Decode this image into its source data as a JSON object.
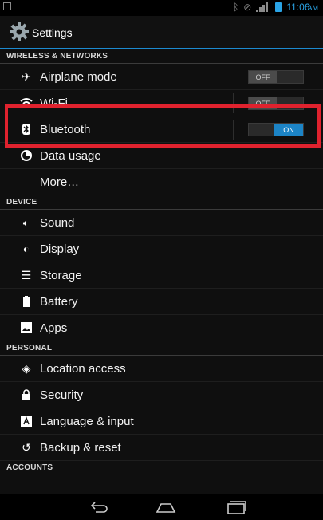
{
  "status_bar": {
    "time": "11:06",
    "ampm": "AM",
    "accent": "#2aa4e6"
  },
  "action_bar": {
    "title": "Settings",
    "icon": "settings-gear-icon"
  },
  "sections": {
    "wireless": "WIRELESS & NETWORKS",
    "device": "DEVICE",
    "personal": "PERSONAL",
    "accounts": "ACCOUNTS"
  },
  "wireless_items": {
    "airplane": {
      "label": "Airplane mode",
      "icon": "airplane-icon",
      "toggle": "OFF"
    },
    "wifi": {
      "label": "Wi-Fi",
      "icon": "wifi-icon",
      "toggle": "OFF"
    },
    "bluetooth": {
      "label": "Bluetooth",
      "icon": "bluetooth-icon",
      "toggle": "ON"
    },
    "data": {
      "label": "Data usage",
      "icon": "data-usage-icon"
    },
    "more": {
      "label": "More…"
    }
  },
  "device_items": [
    {
      "label": "Sound",
      "icon": "sound-icon"
    },
    {
      "label": "Display",
      "icon": "display-icon"
    },
    {
      "label": "Storage",
      "icon": "storage-icon"
    },
    {
      "label": "Battery",
      "icon": "battery-icon"
    },
    {
      "label": "Apps",
      "icon": "apps-icon"
    }
  ],
  "personal_items": [
    {
      "label": "Location access",
      "icon": "location-icon"
    },
    {
      "label": "Security",
      "icon": "lock-icon"
    },
    {
      "label": "Language & input",
      "icon": "language-icon"
    },
    {
      "label": "Backup & reset",
      "icon": "backup-icon"
    }
  ],
  "highlight_color": "#e0222e",
  "switch_on_color": "#1c84c6"
}
